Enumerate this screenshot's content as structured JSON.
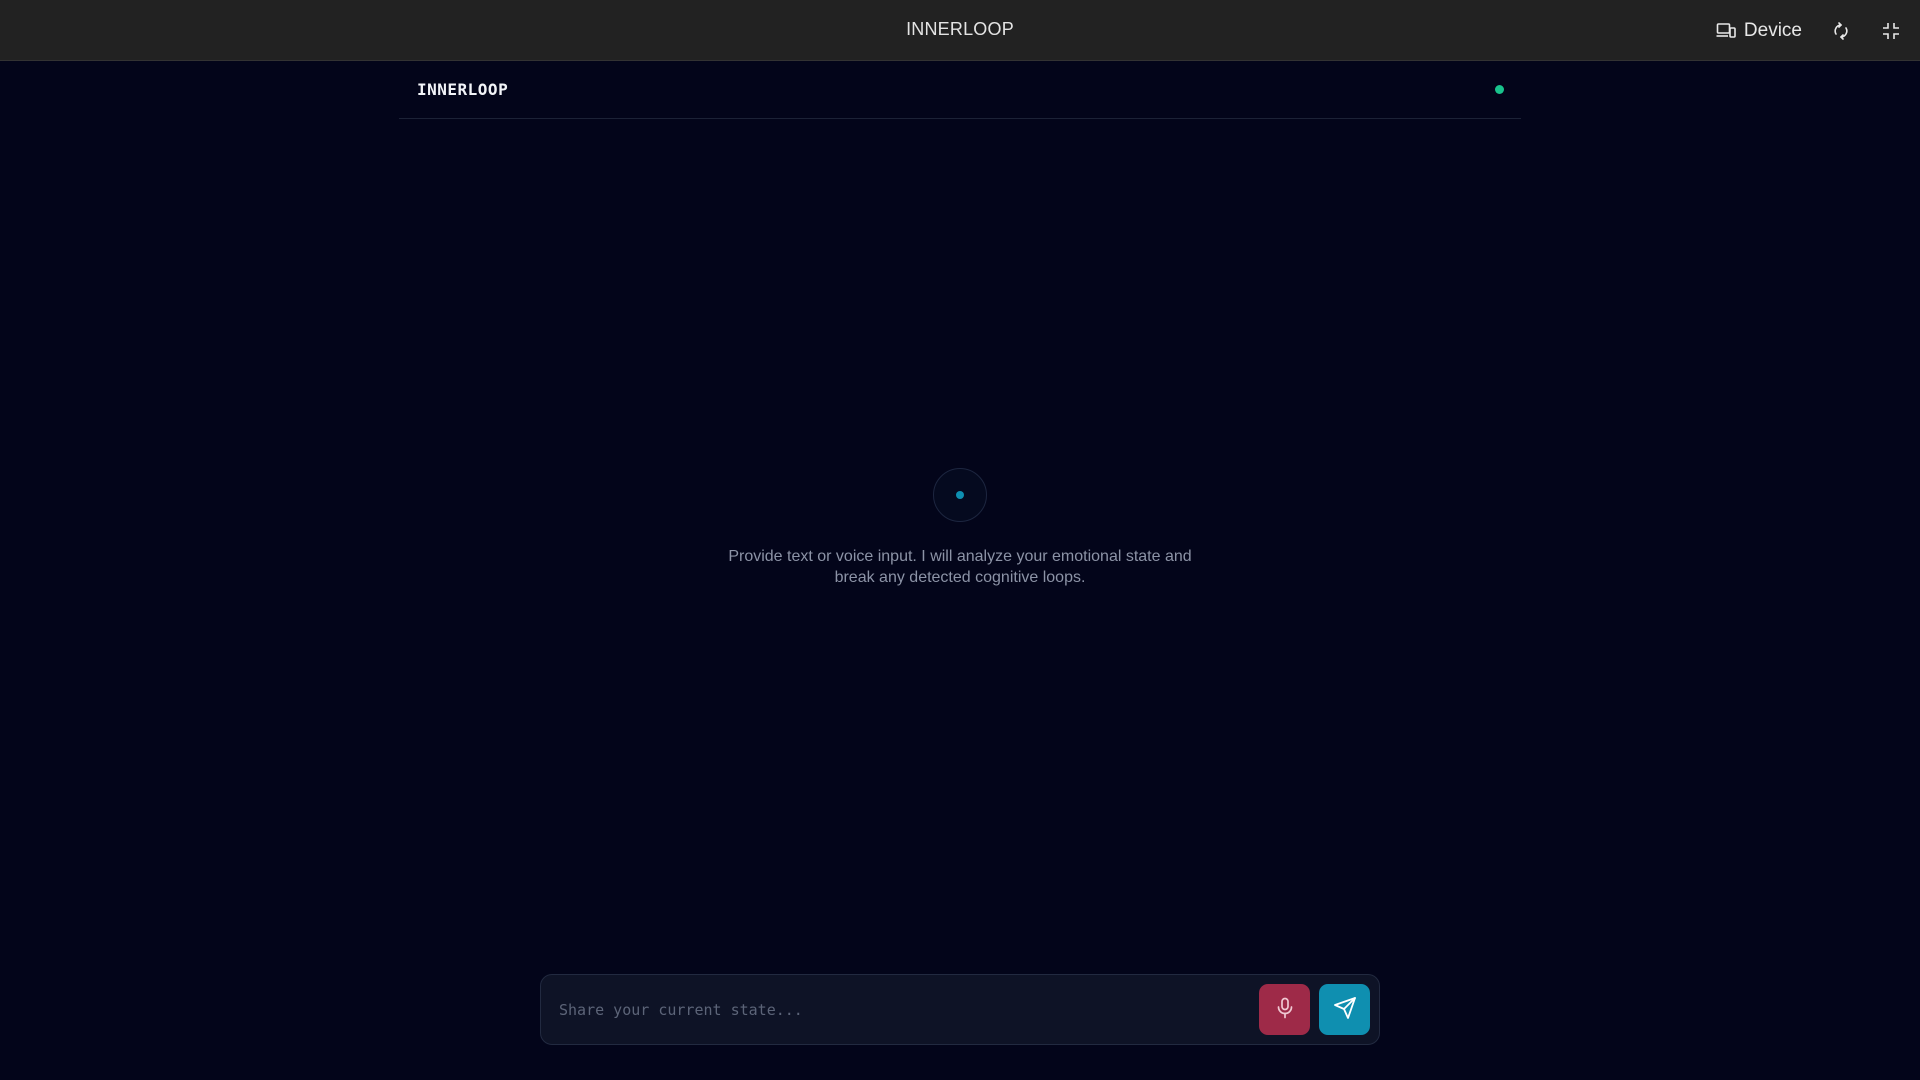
{
  "window": {
    "title": "INNERLOOP",
    "device_label": "Device"
  },
  "icons": {
    "device": "devices-icon",
    "rotate": "rotate-icon",
    "fullscreen": "exit-fullscreen-icon",
    "mic": "microphone-icon",
    "send": "send-icon"
  },
  "app": {
    "logo": "INNERLOOP",
    "status": "online"
  },
  "empty_state": {
    "message": "Provide text or voice input. I will analyze your emotional state and break any detected cognitive loops."
  },
  "composer": {
    "placeholder": "Share your current state...",
    "value": ""
  },
  "colors": {
    "background": "#03051a",
    "status_dot": "#19c38c",
    "mic_button": "#9e2a48",
    "send_button": "#0f8fb0",
    "accent": "#0e8fb1"
  }
}
